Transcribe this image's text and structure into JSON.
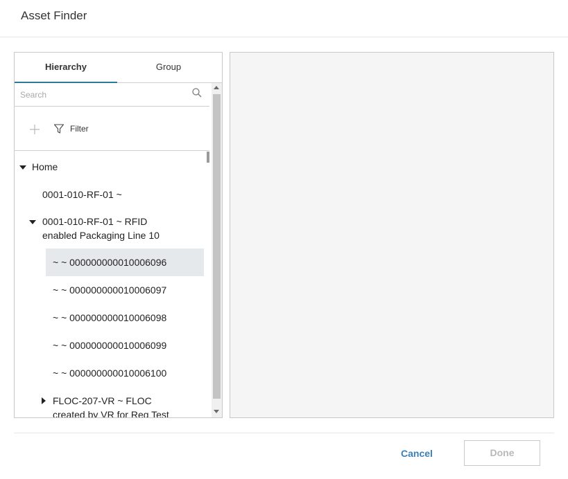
{
  "dialog": {
    "title": "Asset Finder"
  },
  "tabs": [
    {
      "label": "Hierarchy",
      "active": true
    },
    {
      "label": "Group",
      "active": false
    }
  ],
  "search": {
    "placeholder": "Search",
    "value": ""
  },
  "toolbar": {
    "filter_label": "Filter"
  },
  "tree": {
    "home": "Home",
    "item_0001_ref": "0001-010-RF-01 ~",
    "item_0001_line1": "0001-010-RF-01 ~ RFID",
    "item_0001_line2": "enabled Packaging Line 10",
    "children": [
      "~ ~ 000000000010006096",
      "~ ~ 000000000010006097",
      "~ ~ 000000000010006098",
      "~ ~ 000000000010006099",
      "~ ~ 000000000010006100"
    ],
    "floc_line1": "FLOC-207-VR ~ FLOC",
    "floc_line2": "created by VR for Reg Test"
  },
  "footer": {
    "cancel_label": "Cancel",
    "done_label": "Done"
  },
  "colors": {
    "accent": "#2a7a9b",
    "link": "#3b7fb6",
    "selected_row": "#e6e9ec",
    "disabled_text": "#b8b8b8"
  }
}
